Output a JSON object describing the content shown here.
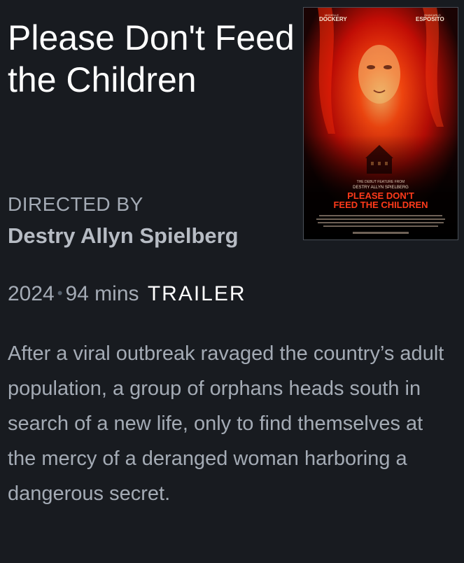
{
  "film": {
    "title": "Please Don't Feed the Children",
    "directed_label": "DIRECTED BY",
    "director": "Destry Allyn Spielberg",
    "year": "2024",
    "runtime": "94 mins",
    "trailer_label": "TRAILER",
    "synopsis": "After a viral outbreak ravaged the country’s adult population, a group of orphans heads south in search of a new life, only to find themselves at the mercy of a deranged woman harboring a dangerous secret."
  },
  "poster": {
    "credit_left_small": "MICHELLE",
    "credit_left": "DOCKERY",
    "credit_right_small": "GIANCARLO",
    "credit_right": "ESPOSITO",
    "tagline_line1": "THE DEBUT FEATURE FROM",
    "tagline_line2": "DESTRY ALLYN SPIELBERG",
    "title_line1": "PLEASE DON'T",
    "title_line2": "FEED THE CHILDREN"
  }
}
